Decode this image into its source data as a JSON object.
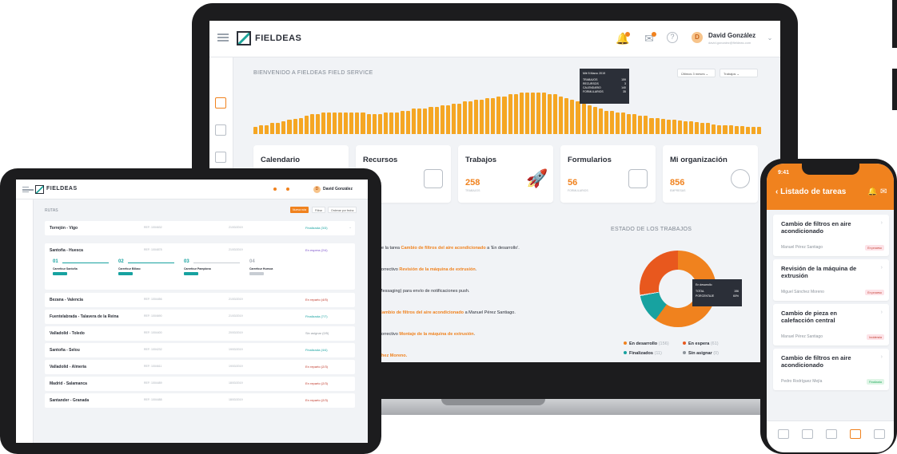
{
  "brand": {
    "logo_text": "FIELDEAS",
    "accent": "#f0821e",
    "teal": "#17a2a0"
  },
  "laptop": {
    "user_initial": "D",
    "user_name": "David González",
    "user_sub": "david.gonzalez@fieldeas.com",
    "welcome": "BIENVENIDO A FIELDEAS FIELD SERVICE",
    "filter_period": "Últimos 3 meses",
    "filter_type": "Trabajos",
    "tooltip": {
      "date": "Mié 5 Marzo 2019",
      "rows": [
        {
          "label": "TRABAJOS",
          "value": "159"
        },
        {
          "label": "RECURSOS",
          "value": "3"
        },
        {
          "label": "CALENDARIO",
          "value": "140"
        },
        {
          "label": "FORMULARIOS",
          "value": "35"
        }
      ]
    },
    "bar_values": [
      8,
      10,
      10,
      12,
      12,
      14,
      16,
      17,
      18,
      20,
      22,
      22,
      24,
      24,
      24,
      24,
      24,
      24,
      24,
      24,
      22,
      22,
      22,
      24,
      24,
      24,
      26,
      26,
      28,
      28,
      28,
      30,
      30,
      32,
      32,
      34,
      34,
      36,
      36,
      38,
      38,
      40,
      40,
      42,
      42,
      44,
      44,
      46,
      46,
      46,
      46,
      46,
      44,
      44,
      42,
      40,
      38,
      36,
      34,
      32,
      30,
      28,
      26,
      26,
      24,
      24,
      22,
      22,
      20,
      20,
      18,
      18,
      17,
      16,
      16,
      15,
      14,
      14,
      13,
      12,
      12,
      11,
      10,
      10,
      10,
      9,
      9,
      8,
      8,
      8
    ],
    "cards": [
      {
        "title": "Calendario",
        "num": "",
        "sub": ""
      },
      {
        "title": "Recursos",
        "num": "",
        "sub": ""
      },
      {
        "title": "Trabajos",
        "num": "258",
        "sub": "TRABAJOS"
      },
      {
        "title": "Formularios",
        "num": "56",
        "sub": "FORMULARIOS"
      },
      {
        "title": "Mi organización",
        "num": "856",
        "sub": "EMPRESAS"
      }
    ],
    "estado_title": "ESTADO DE LOS TRABAJOS",
    "donut_tooltip": {
      "label": "En desarrollo",
      "rows": [
        {
          "label": "TOTAL",
          "value": "156"
        },
        {
          "label": "PORCENTAJE",
          "value": "60%"
        }
      ]
    },
    "legend": [
      {
        "label": "En desarrollo",
        "count": "(156)",
        "color": "#f0821e"
      },
      {
        "label": "En espera",
        "count": "(61)",
        "color": "#e8581e"
      },
      {
        "label": "Finalizados",
        "count": "(11)",
        "color": "#17a2a0"
      },
      {
        "label": "Sin asignar",
        "count": "(0)",
        "color": "#8d949c"
      }
    ],
    "activity": [
      {
        "pre": "de la tarea ",
        "hl": "Cambio de filtros del aire acondicionado",
        "post": " a 'En desarrollo'."
      },
      {
        "pre": "correctivo ",
        "hl": "Revisión de la máquina de extrusión",
        "post": "."
      },
      {
        "pre": "Messaging) para envío de notificaciones push.",
        "hl": "",
        "post": ""
      },
      {
        "pre": "",
        "hl": "Cambio de filtros del aire acondicionado",
        "post": " a Manuel Pérez Santiago."
      },
      {
        "pre": "correctivo ",
        "hl": "Montaje de la máquina de extrusión",
        "post": "."
      },
      {
        "pre": "",
        "hl": "chez Moreno.",
        "post": ""
      }
    ]
  },
  "tablet": {
    "user_name": "David González",
    "section": "RUTAS",
    "buttons": [
      "Nueva ruta",
      "Filtrar",
      "Ordenar por fecha"
    ],
    "rows": [
      {
        "name": "Torrejón - Vigo",
        "ref": "REF: 1004632",
        "date": "21/03/2019",
        "status": "Finalizada (3/3)",
        "color": "#17a2a0"
      },
      {
        "name": "Santoña - Huesca",
        "ref": "REF: 1004878",
        "date": "21/03/2019",
        "status": "En espera (2/4)",
        "color": "#7a4fc9"
      },
      {
        "name": "Bezana - Valencia",
        "ref": "REF: 1004456",
        "date": "21/03/2019",
        "status": "En reparto (4/5)",
        "color": "#c0392b"
      },
      {
        "name": "Fuentelabrada - Talavera de la Reina",
        "ref": "REF: 1004690",
        "date": "21/03/2019",
        "status": "Finalizada (7/7)",
        "color": "#17a2a0"
      },
      {
        "name": "Valladolid - Toledo",
        "ref": "REF: 1004400",
        "date": "20/03/2019",
        "status": "Sin asignar (0/5)",
        "color": "#8d949c"
      },
      {
        "name": "Santoña - Selou",
        "ref": "REF: 1004232",
        "date": "19/03/2019",
        "status": "Finalizada (4/4)",
        "color": "#17a2a0"
      },
      {
        "name": "Valladolid - Almería",
        "ref": "REF: 1004611",
        "date": "19/03/2019",
        "status": "En reparto (2/3)",
        "color": "#c0392b"
      },
      {
        "name": "Madrid - Salamanca",
        "ref": "REF: 1004489",
        "date": "18/03/2019",
        "status": "En reparto (2/3)",
        "color": "#c0392b"
      },
      {
        "name": "Santander - Granada",
        "ref": "REF: 1004488",
        "date": "18/03/2019",
        "status": "En reparto (2/3)",
        "color": "#c0392b"
      }
    ],
    "steps": [
      {
        "num": "01",
        "label": "Carrefour Santoña"
      },
      {
        "num": "02",
        "label": "Carrefour Bilbao"
      },
      {
        "num": "03",
        "label": "Carrefour Pamplona"
      },
      {
        "num": "04",
        "label": "Carrefour Huesca"
      }
    ]
  },
  "phone": {
    "time": "9:41",
    "title": "Listado de tareas",
    "tasks": [
      {
        "title": "Cambio de filtros en aire acondicionado",
        "user": "Manuel Pérez Santiago",
        "badge": "En proceso",
        "bg": "#fde3e8",
        "fg": "#c0392b"
      },
      {
        "title": "Revisión de la máquina de extrusión",
        "user": "Miguel Sánchez Moreno",
        "badge": "En proceso",
        "bg": "#fde3e8",
        "fg": "#c0392b"
      },
      {
        "title": "Cambio de pieza en calefacción central",
        "user": "Manuel Pérez Santiago",
        "badge": "Incidencia",
        "bg": "#fde3e8",
        "fg": "#c0392b"
      },
      {
        "title": "Cambio de filtros en aire acondicionado",
        "user": "Pedro Rodríguez Mejía",
        "badge": "Finalizada",
        "bg": "#dff5e6",
        "fg": "#27ae60"
      }
    ]
  }
}
